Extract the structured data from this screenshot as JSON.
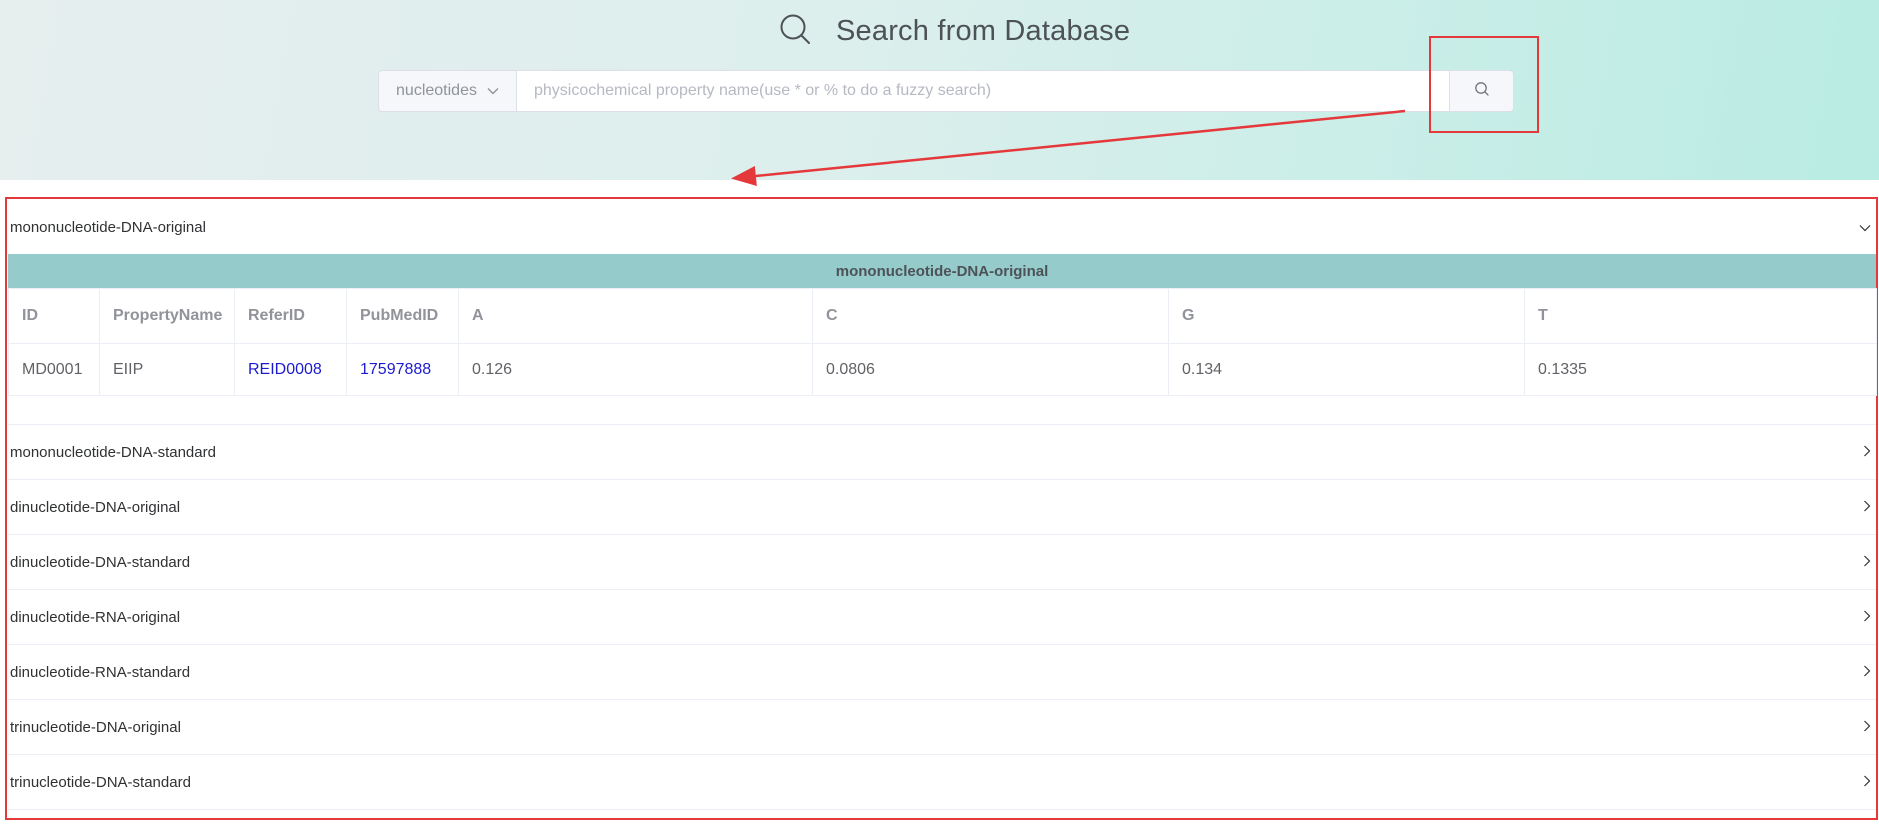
{
  "header": {
    "title": "Search from Database",
    "title_icon": "search-icon"
  },
  "search": {
    "type_selected": "nucleotides",
    "input_value": "",
    "placeholder": "physicochemical property name(use * or % to do a fuzzy search)",
    "button_icon": "search-icon"
  },
  "colors": {
    "annotation": "#e5383b",
    "table_header_bar": "#96cbcb",
    "link": "#1c1ccf"
  },
  "results": {
    "expanded": {
      "title": "mononucleotide-DNA-original",
      "table_title": "mononucleotide-DNA-original",
      "columns": [
        "ID",
        "PropertyName",
        "ReferID",
        "PubMedID",
        "A",
        "C",
        "G",
        "T"
      ],
      "rows": [
        [
          "MD0001",
          "EIIP",
          "REID0008",
          "17597888",
          "0.126",
          "0.0806",
          "0.134",
          "0.1335"
        ]
      ]
    },
    "collapsed": [
      "mononucleotide-DNA-standard",
      "dinucleotide-DNA-original",
      "dinucleotide-DNA-standard",
      "dinucleotide-RNA-original",
      "dinucleotide-RNA-standard",
      "trinucleotide-DNA-original",
      "trinucleotide-DNA-standard"
    ]
  }
}
